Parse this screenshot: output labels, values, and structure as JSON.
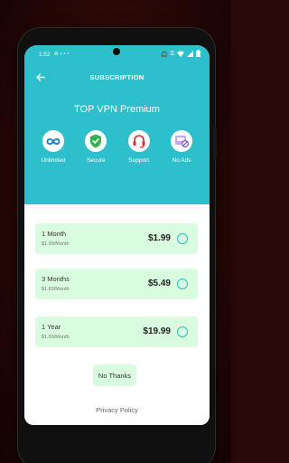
{
  "status_bar": {
    "time": "1:52",
    "icons": [
      "settings-icon",
      "message-icon",
      "sim-icon",
      "dot-icon"
    ],
    "right_icons": [
      "headphones-icon",
      "vpn-key-icon",
      "wifi-icon",
      "signal-icon",
      "battery-icon"
    ]
  },
  "appbar": {
    "title": "SUBSCRIPTION"
  },
  "product": {
    "title": "TOP VPN Premium"
  },
  "features": [
    {
      "icon": "infinity-icon",
      "label": "Unlimited"
    },
    {
      "icon": "shield-check-icon",
      "label": "Secure"
    },
    {
      "icon": "headset-icon",
      "label": "Support"
    },
    {
      "icon": "no-ads-icon",
      "label": "No Ads"
    }
  ],
  "plans": [
    {
      "name": "1 Month",
      "per_month": "$1.99/Month",
      "price": "$1.99",
      "selected": false
    },
    {
      "name": "3 Months",
      "per_month": "$1.83/Month",
      "price": "$5.49",
      "selected": false
    },
    {
      "name": "1 Year",
      "per_month": "$1.66/Month",
      "price": "$19.99",
      "selected": false
    }
  ],
  "actions": {
    "no_thanks": "No Thanks",
    "privacy_policy": "Privacy Policy"
  },
  "colors": {
    "header": "#2ebfcc",
    "plan_card": "#d9fbdf",
    "radio": "#2ebfcc",
    "shield": "#32b24a",
    "headset": "#e0282e",
    "infinity": "#1b78c4"
  }
}
